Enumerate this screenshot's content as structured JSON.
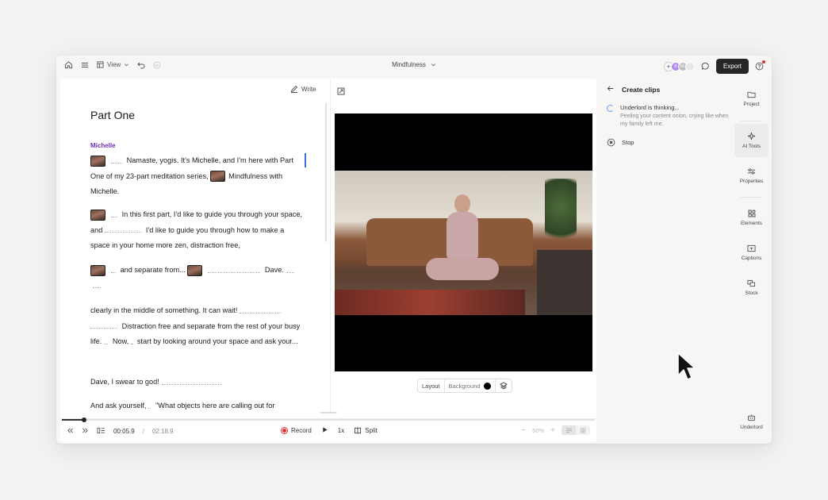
{
  "topbar": {
    "view_label": "View",
    "project_title": "Mindfulness",
    "avatar_initials": [
      "B",
      "ML"
    ],
    "export_label": "Export"
  },
  "transcript": {
    "write_label": "Write",
    "title": "Part One",
    "speaker": "Michelle",
    "p1": {
      "a": "Namaste, yogis. It's Michelle, and I'm here with Part One of my 23-part meditation series,",
      "b": "Mindfulness with Michelle."
    },
    "p2": {
      "a": "In this first part, I'd like to guide you through your space, and",
      "b": "I'd like to guide you through how to make a space in your home more zen, distraction free,"
    },
    "p3": {
      "a": "and separate from...",
      "b": "Dave."
    },
    "p4": {
      "a": "clearly in the middle of something. It can wait!",
      "b": "Distraction free and separate from the rest of your busy life.",
      "c": "Now,",
      "d": "start by looking around your space and ask your..."
    },
    "p5": "Dave, I swear to god!",
    "p6": {
      "a": "And ask yourself,",
      "b": "\"What objects here are calling out for"
    }
  },
  "preview": {
    "layout_label": "Layout",
    "background_label": "Background",
    "background_color": "#000000"
  },
  "timeline": {
    "current_time": "00:05.9",
    "separator": "/",
    "total_time": "02:18.9",
    "progress": 0.042,
    "record_label": "Record",
    "speed_label": "1x",
    "split_label": "Split",
    "zoom_label": "50%"
  },
  "side_panel": {
    "title": "Create clips",
    "thinking_title": "Underlord is thinking...",
    "thinking_sub": "Peeling your content onion, crying like when my family left me.",
    "stop_label": "Stop"
  },
  "rail": {
    "project": "Project",
    "ai_tools": "AI Tools",
    "properties": "Properties",
    "elements": "Elements",
    "captions": "Captions",
    "stock": "Stock",
    "underlord": "Underlord"
  }
}
